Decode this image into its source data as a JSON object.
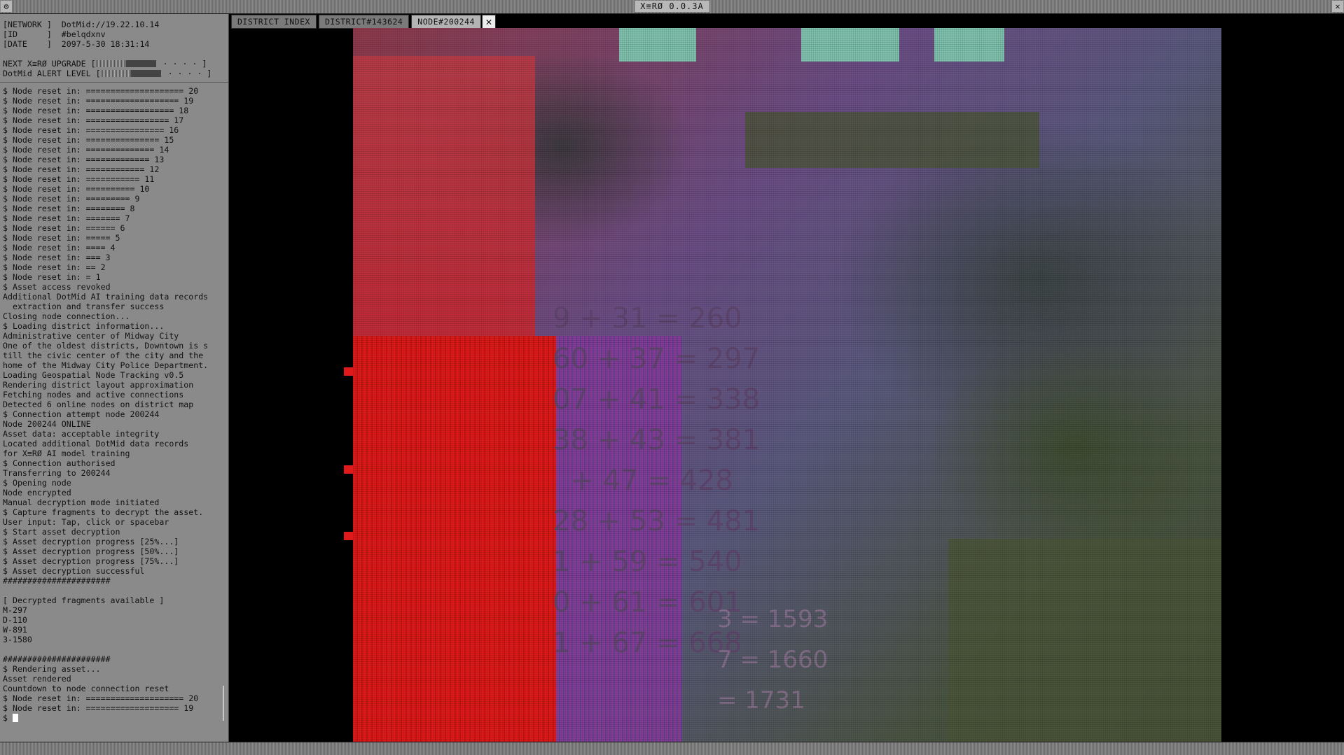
{
  "window": {
    "title": "X≡RØ 0.0.3A",
    "menu_icon": "⚙",
    "close_icon": "✕"
  },
  "terminal": {
    "header": [
      "[NETWORK ]  DotMid://19.22.10.14",
      "[ID      ]  #belqdxnv",
      "[DATE    ]  2097-5-30 18:31:14"
    ],
    "meters": [
      {
        "label": "NEXT X≡RØ UPGRADE [",
        "level": 0.6,
        "dots": "· · · · ]"
      },
      {
        "label": "DotMid ALERT LEVEL [",
        "level": 0.6,
        "dots": "· · · · ]"
      }
    ],
    "log": [
      "$ Node reset in: ==================== 20",
      "$ Node reset in: =================== 19",
      "$ Node reset in: ================== 18",
      "$ Node reset in: ================= 17",
      "$ Node reset in: ================ 16",
      "$ Node reset in: =============== 15",
      "$ Node reset in: ============== 14",
      "$ Node reset in: ============= 13",
      "$ Node reset in: ============ 12",
      "$ Node reset in: =========== 11",
      "$ Node reset in: ========== 10",
      "$ Node reset in: ========= 9",
      "$ Node reset in: ======== 8",
      "$ Node reset in: ======= 7",
      "$ Node reset in: ====== 6",
      "$ Node reset in: ===== 5",
      "$ Node reset in: ==== 4",
      "$ Node reset in: === 3",
      "$ Node reset in: == 2",
      "$ Node reset in: = 1",
      "$ Asset access revoked",
      "Additional DotMid AI training data records",
      "  extraction and transfer success",
      "Closing node connection...",
      "$ Loading district information...",
      "Administrative center of Midway City",
      "One of the oldest districts, Downtown is s",
      "till the civic center of the city and the",
      "home of the Midway City Police Department.",
      "Loading Geospatial Node Tracking v0.5",
      "Rendering district layout approximation",
      "Fetching nodes and active connections",
      "Detected 6 online nodes on district map",
      "$ Connection attempt node 200244",
      "Node 200244 ONLINE",
      "Asset data: acceptable integrity",
      "Located additional DotMid data records",
      "for X≡RØ AI model training",
      "$ Connection authorised",
      "Transferring to 200244",
      "$ Opening node",
      "Node encrypted",
      "Manual decryption mode initiated",
      "$ Capture fragments to decrypt the asset.",
      "User input: Tap, click or spacebar",
      "$ Start asset decryption",
      "$ Asset decryption progress [25%...]",
      "$ Asset decryption progress [50%...]",
      "$ Asset decryption progress [75%...]",
      "$ Asset decryption successful",
      "######################",
      "",
      "[ Decrypted fragments available ]",
      "M-297",
      "D-110",
      "W-891",
      "3-1580",
      "",
      "######################",
      "$ Rendering asset...",
      "Asset rendered",
      "Countdown to node connection reset",
      "$ Node reset in: ==================== 20",
      "$ Node reset in: =================== 19"
    ],
    "prompt": "$ "
  },
  "tabs": [
    {
      "label": "DISTRICT INDEX",
      "active": false
    },
    {
      "label": "DISTRICT#143624",
      "active": false
    },
    {
      "label": "NODE#200244",
      "active": true
    }
  ],
  "tab_close_icon": "✕",
  "artwork": {
    "equations": [
      "9 + 31 = 260",
      "60 + 37 = 297",
      "07 + 41 = 338",
      "38 + 43 = 381",
      "  + 47 = 428",
      "28 + 53 = 481",
      "1 + 59 = 540",
      "0 + 61 = 601",
      "1 + 67 = 668"
    ],
    "equations_right": [
      "3 = 1593",
      "7 = 1660",
      "= 1731"
    ]
  }
}
